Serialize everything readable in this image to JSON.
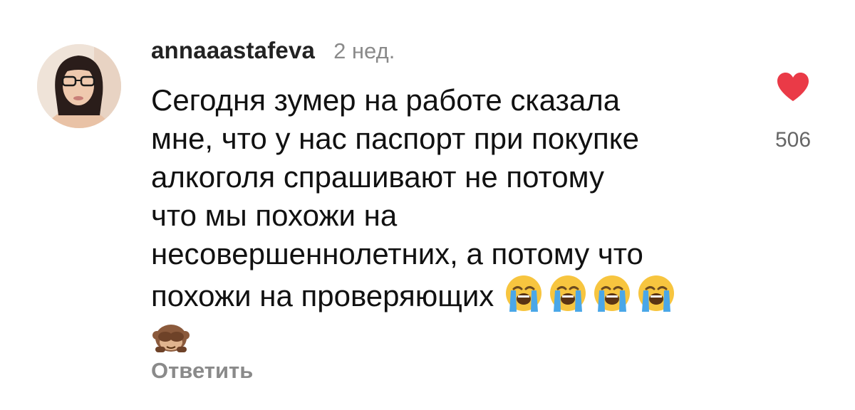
{
  "comment": {
    "username": "annaaastafeva",
    "time_ago": "2 нед.",
    "text": "Сегодня зумер на работе сказала\nмне, что у нас паспорт при покупке\nалкоголя спрашивают не потому\nчто мы похожи на\nнесовершеннолетних, а потому что\nпохожи на проверяющих",
    "emojis_line1": [
      "loudly-crying-face",
      "loudly-crying-face",
      "loudly-crying-face",
      "loudly-crying-face"
    ],
    "emojis_line2": [
      "see-no-evil-monkey"
    ],
    "reply_label": "Ответить",
    "like_count": "506",
    "liked": true,
    "colors": {
      "heart": "#ea3a47",
      "muted": "#8a8a8a"
    }
  }
}
